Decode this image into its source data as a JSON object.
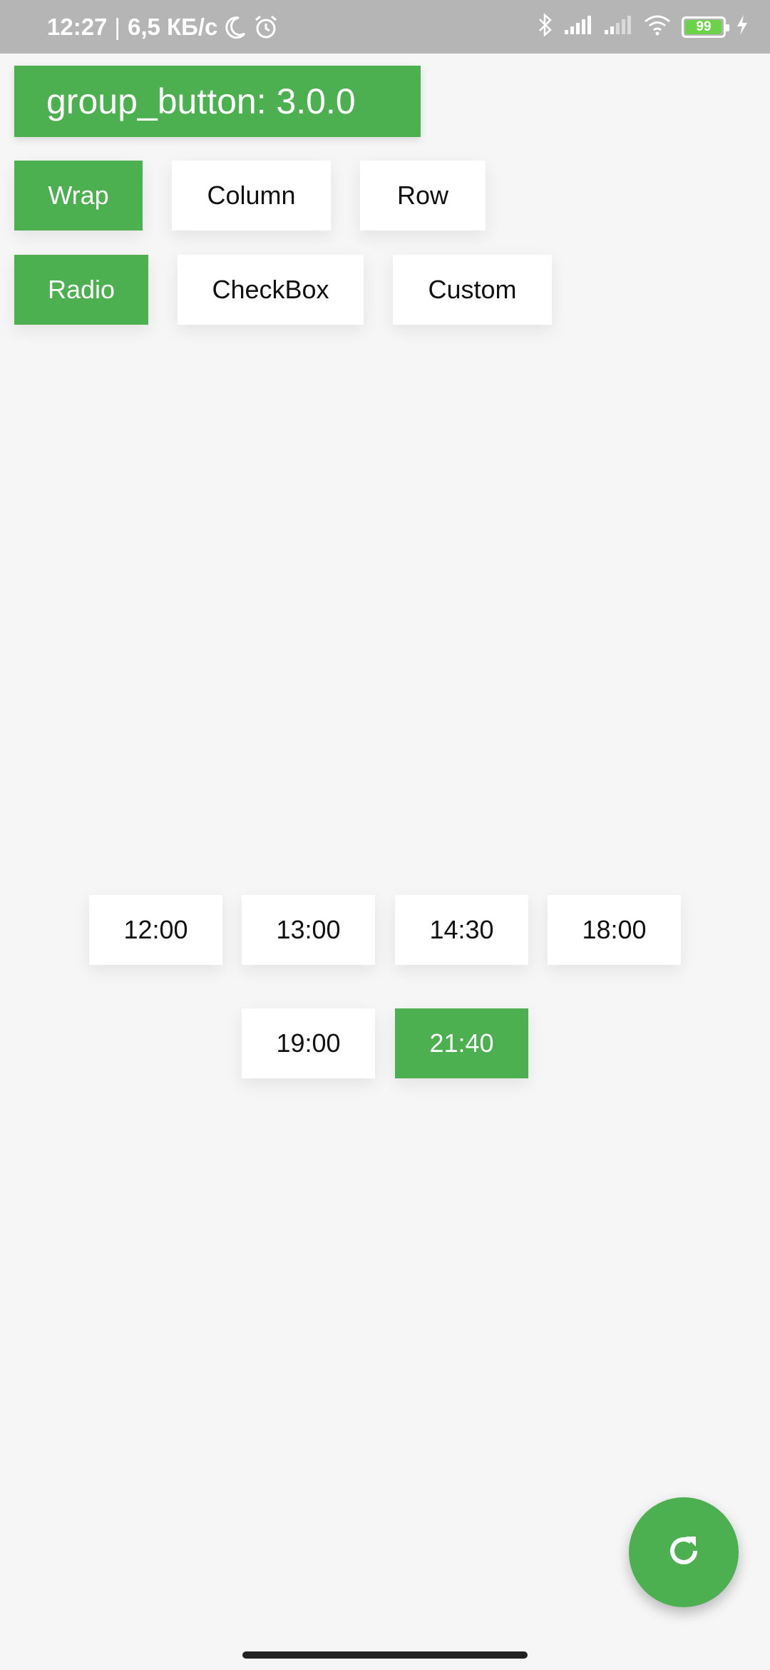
{
  "status_bar": {
    "time": "12:27",
    "separator": "|",
    "speed": "6,5 КБ/с",
    "battery_level": "99",
    "battery_fraction": 0.99,
    "icons": [
      "moon-icon",
      "alarm-icon",
      "bluetooth-icon",
      "signal-icon",
      "signal-icon",
      "wifi-icon",
      "battery-icon",
      "charging-icon"
    ]
  },
  "header": {
    "title": "group_button: 3.0.0"
  },
  "layout_group": {
    "buttons": [
      {
        "label": "Wrap",
        "selected": true
      },
      {
        "label": "Column",
        "selected": false
      },
      {
        "label": "Row",
        "selected": false
      }
    ]
  },
  "type_group": {
    "buttons": [
      {
        "label": "Radio",
        "selected": true
      },
      {
        "label": "CheckBox",
        "selected": false
      },
      {
        "label": "Custom",
        "selected": false
      }
    ]
  },
  "time_group": {
    "buttons": [
      {
        "label": "12:00",
        "selected": false
      },
      {
        "label": "13:00",
        "selected": false
      },
      {
        "label": "14:30",
        "selected": false
      },
      {
        "label": "18:00",
        "selected": false
      },
      {
        "label": "19:00",
        "selected": false
      },
      {
        "label": "21:40",
        "selected": true
      }
    ]
  },
  "fab": {
    "icon": "refresh-icon"
  },
  "colors": {
    "accent": "#4caf50",
    "status_bar": "#b5b5b5",
    "background": "#f6f6f6"
  }
}
